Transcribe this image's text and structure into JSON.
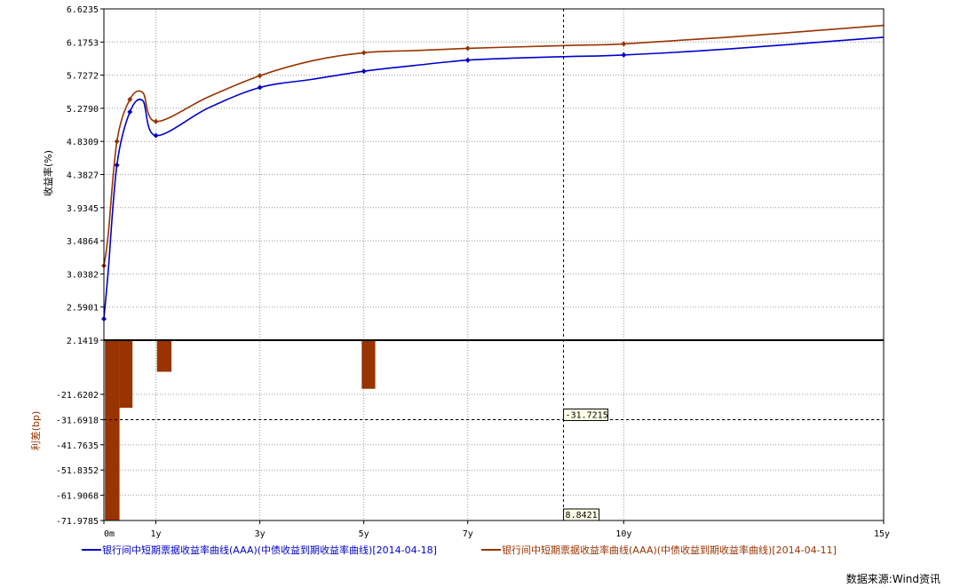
{
  "chart_data": {
    "type": "line",
    "x_ticks": [
      {
        "t": 0,
        "label": "0m"
      },
      {
        "t": 1,
        "label": "1y"
      },
      {
        "t": 3,
        "label": "3y"
      },
      {
        "t": 5,
        "label": "5y"
      },
      {
        "t": 7,
        "label": "7y"
      },
      {
        "t": 10,
        "label": "10y"
      },
      {
        "t": 15,
        "label": "15y"
      }
    ],
    "xlim": [
      0,
      15
    ],
    "upper_panel": {
      "ylabel": "收益率(%)",
      "ylim": [
        2.1419,
        6.6235
      ],
      "y_ticks": [
        "6.6235",
        "6.1753",
        "5.7272",
        "5.2790",
        "4.8309",
        "4.3827",
        "3.9345",
        "3.4864",
        "3.0382",
        "2.5901",
        "2.1419"
      ],
      "series": [
        {
          "name": "银行间中短期票据收益率曲线(AAA)(中债收益到期收益率曲线)[2014-04-18]",
          "color": "#0000cc",
          "x": [
            0,
            0.08,
            0.25,
            0.5,
            0.75,
            1,
            2,
            3,
            4,
            5,
            6,
            7,
            8,
            9,
            10,
            12,
            15
          ],
          "y": [
            2.43,
            3.05,
            4.51,
            5.23,
            5.38,
            4.91,
            5.28,
            5.56,
            5.67,
            5.78,
            5.86,
            5.93,
            5.96,
            5.98,
            6.0,
            6.08,
            6.24
          ]
        },
        {
          "name": "银行间中短期票据收益率曲线(AAA)(中债收益到期收益率曲线)[2014-04-11]",
          "color": "#993300",
          "x": [
            0,
            0.08,
            0.25,
            0.5,
            0.75,
            1,
            2,
            3,
            4,
            5,
            6,
            7,
            8,
            9,
            10,
            12,
            15
          ],
          "y": [
            3.15,
            3.55,
            4.83,
            5.4,
            5.49,
            5.1,
            5.43,
            5.72,
            5.92,
            6.03,
            6.06,
            6.09,
            6.11,
            6.13,
            6.15,
            6.24,
            6.4
          ]
        }
      ],
      "markers_x": [
        0,
        0.25,
        0.5,
        1,
        3,
        5,
        7,
        10
      ]
    },
    "lower_panel": {
      "type": "bar",
      "ylabel": "利差(bp)",
      "ylim": [
        -71.9785,
        -11.5
      ],
      "zero_line": 0,
      "y_ticks": [
        "-21.6202",
        "-31.6918",
        "-41.7635",
        "-51.8352",
        "-61.9068",
        "-71.9785"
      ],
      "bars": [
        {
          "x0": 0.02,
          "x1": 0.3,
          "value": -72
        },
        {
          "x0": 0.3,
          "x1": 0.55,
          "value": -27
        },
        {
          "x0": 1.02,
          "x1": 1.3,
          "value": -12.6
        },
        {
          "x0": 4.96,
          "x1": 5.22,
          "value": -19.4
        }
      ],
      "bar_color": "#993300"
    },
    "crosshair": {
      "x_label": "8.8421",
      "y_label": "-31.7215",
      "x_value": 8.8421,
      "y_value": -31.7215
    }
  },
  "source": "数据来源:Wind资讯"
}
